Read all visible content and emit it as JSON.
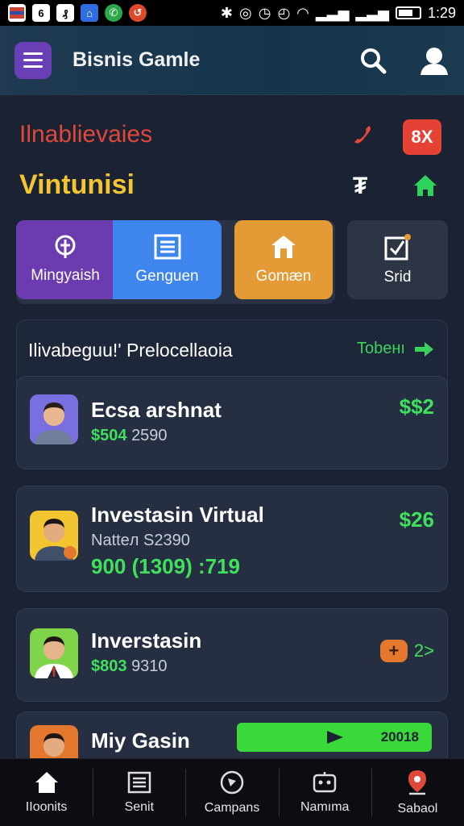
{
  "status_bar": {
    "time": "1:29",
    "notifications": [
      {
        "icon": "flag-icon",
        "color": "#c74535"
      },
      {
        "icon": "notification-icon",
        "color": "#ffffff"
      },
      {
        "icon": "app-icon",
        "color": "#ffffff"
      },
      {
        "icon": "app-icon",
        "color": "#2f6de0"
      },
      {
        "icon": "phone-icon",
        "color": "#2aa84a"
      },
      {
        "icon": "app-icon",
        "color": "#e04a2c"
      }
    ]
  },
  "header": {
    "title": "Bisnis Gamle",
    "menu_icon": "menu-icon",
    "search_icon": "search-icon",
    "profile_icon": "user-icon",
    "accent": "#6a3fb5"
  },
  "section_a": {
    "title": "Ilnablievaies",
    "badge": "8X",
    "phone_icon": "phone-icon",
    "color": "#e0483a"
  },
  "section_b": {
    "title": "Vintunisi",
    "icon1": "₮",
    "home_icon": "home-icon",
    "color": "#f2c531"
  },
  "tiles": [
    {
      "label": "Mingyaish",
      "icon": "target-icon",
      "color": "#6c3bb0"
    },
    {
      "label": "Genguen",
      "icon": "list-icon",
      "color": "#3e86ee"
    },
    {
      "label": "Gomæn",
      "icon": "house-icon",
      "color": "#e49a35"
    },
    {
      "label": "Srid",
      "icon": "checkbox-icon",
      "color": "#2d3545"
    }
  ],
  "panel": {
    "title": "Ilivabeguu!' Prelocellaoia",
    "link": "Tobeнı"
  },
  "cards": [
    {
      "name": "Ecsa arshnat",
      "sub_green": "$504",
      "sub_rest": "2590",
      "amount": "$$2"
    },
    {
      "name": "Investasin Virtual",
      "sub": "Natteл S2390",
      "value": "900 (1309) :719",
      "amount": "$26"
    },
    {
      "name": "Inverstasin",
      "sub_green": "$803",
      "sub_rest": "9310",
      "badge": "+",
      "trail": "2>"
    },
    {
      "name": "Miy Gasin",
      "progress_label": "20018",
      "progress_value": 1.0
    }
  ],
  "bottom_nav": [
    {
      "label": "IIoonits",
      "icon": "home-icon"
    },
    {
      "label": "Senit",
      "icon": "list-icon"
    },
    {
      "label": "Campans",
      "icon": "compass-icon"
    },
    {
      "label": "Namıma",
      "icon": "robot-icon"
    },
    {
      "label": "Sabaol",
      "icon": "location-icon"
    }
  ]
}
